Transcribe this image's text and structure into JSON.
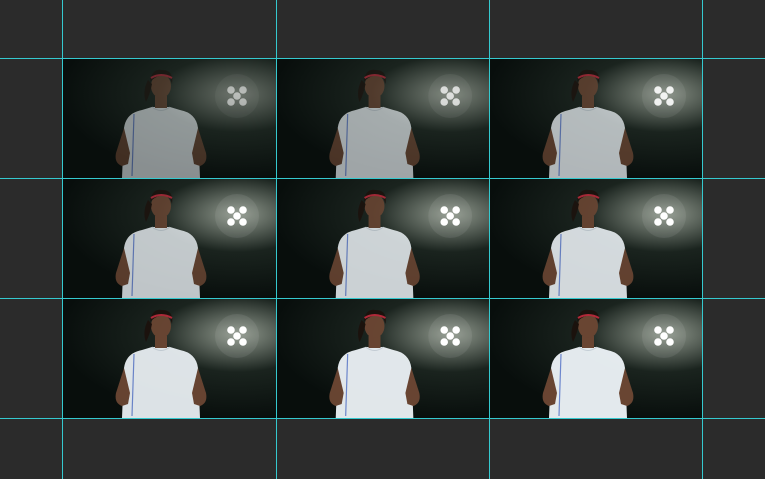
{
  "app": {
    "name": ""
  },
  "contact_sheet": {
    "rows": 3,
    "cols": 3,
    "frames": [
      {
        "id": "frame-1",
        "brightness": 0.35,
        "light_intensity": 0.55
      },
      {
        "id": "frame-2",
        "brightness": 0.5,
        "light_intensity": 0.75
      },
      {
        "id": "frame-3",
        "brightness": 0.62,
        "light_intensity": 0.9
      },
      {
        "id": "frame-4",
        "brightness": 0.72,
        "light_intensity": 1.0
      },
      {
        "id": "frame-5",
        "brightness": 0.8,
        "light_intensity": 1.0
      },
      {
        "id": "frame-6",
        "brightness": 0.85,
        "light_intensity": 1.0
      },
      {
        "id": "frame-7",
        "brightness": 0.92,
        "light_intensity": 1.0
      },
      {
        "id": "frame-8",
        "brightness": 0.95,
        "light_intensity": 1.0
      },
      {
        "id": "frame-9",
        "brightness": 0.97,
        "light_intensity": 1.0
      }
    ]
  },
  "colors": {
    "workspace_bg": "#2b2b2b",
    "guide_line": "#35c9cf",
    "frame_bg": "#060b0a",
    "jersey": "#e8eef2",
    "skin": "#6b4633",
    "hair": "#1c120d",
    "headband": "#b52a3a",
    "trim_blue": "#3b5fc4",
    "light": "#ffffff"
  }
}
